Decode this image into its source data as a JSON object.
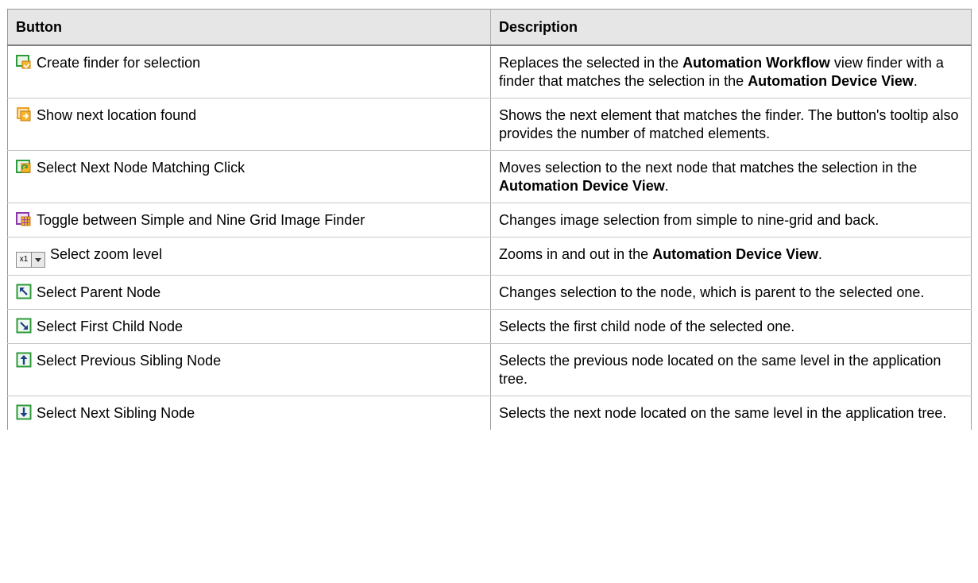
{
  "table": {
    "headers": [
      "Button",
      "Description"
    ],
    "rows": [
      {
        "icon": "create-finder-icon",
        "label": "Create finder for selection",
        "desc": [
          {
            "t": "Replaces the selected in the ",
            "b": false
          },
          {
            "t": "Automation Workflow",
            "b": true
          },
          {
            "t": " view finder with a finder that matches the selection in the ",
            "b": false
          },
          {
            "t": "Automation Device View",
            "b": true
          },
          {
            "t": ".",
            "b": false
          }
        ]
      },
      {
        "icon": "next-location-icon",
        "label": "Show next location found",
        "desc": [
          {
            "t": "Shows the next element that matches the finder. The button's tooltip also provides the number of matched elements.",
            "b": false
          }
        ]
      },
      {
        "icon": "next-node-matching-icon",
        "label": "Select Next Node Matching Click",
        "desc": [
          {
            "t": "Moves selection to the next node that matches the selection in the ",
            "b": false
          },
          {
            "t": "Automation Device View",
            "b": true
          },
          {
            "t": ".",
            "b": false
          }
        ]
      },
      {
        "icon": "nine-grid-toggle-icon",
        "label": "Toggle between Simple and Nine Grid Image Finder",
        "desc": [
          {
            "t": "Changes image selection from simple to nine-grid and back.",
            "b": false
          }
        ]
      },
      {
        "icon": "zoom-select-icon",
        "zoom_value": "x1",
        "label": "Select zoom level",
        "desc": [
          {
            "t": "Zooms in and out in the ",
            "b": false
          },
          {
            "t": "Automation Device View",
            "b": true
          },
          {
            "t": ".",
            "b": false
          }
        ]
      },
      {
        "icon": "parent-node-icon",
        "label": "Select Parent Node",
        "desc": [
          {
            "t": "Changes selection to the node, which is parent to the selected one.",
            "b": false
          }
        ]
      },
      {
        "icon": "first-child-node-icon",
        "label": "Select First Child Node",
        "desc": [
          {
            "t": "Selects the first child node of the selected one.",
            "b": false
          }
        ]
      },
      {
        "icon": "previous-sibling-node-icon",
        "label": "Select Previous Sibling Node",
        "desc": [
          {
            "t": "Selects the previous node located on the same level in the application tree.",
            "b": false
          }
        ]
      },
      {
        "icon": "next-sibling-node-icon",
        "label": "Select Next Sibling Node",
        "desc": [
          {
            "t": "Selects the next node located on the same level in the application tree.",
            "b": false
          }
        ]
      }
    ]
  },
  "colors": {
    "header_bg": "#e6e6e6",
    "icon_green": "#2e9a3a",
    "icon_orange": "#f0a020",
    "icon_purple": "#8a3aa8",
    "icon_blue": "#1e3f8a"
  }
}
